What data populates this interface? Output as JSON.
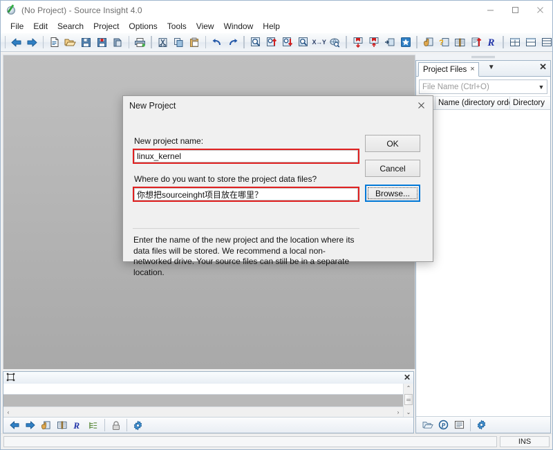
{
  "window": {
    "title": "(No Project) - Source Insight 4.0",
    "app_icon": "source-insight-icon",
    "minimize": "minimize-icon",
    "maximize": "maximize-icon",
    "close": "close-icon"
  },
  "menubar": {
    "items": [
      {
        "label": "File"
      },
      {
        "label": "Edit"
      },
      {
        "label": "Search"
      },
      {
        "label": "Project"
      },
      {
        "label": "Options"
      },
      {
        "label": "Tools"
      },
      {
        "label": "View"
      },
      {
        "label": "Window"
      },
      {
        "label": "Help"
      }
    ]
  },
  "toolbar": {
    "groups": [
      {
        "buttons": [
          {
            "name": "back-arrow-icon",
            "icon": "arrow-left"
          },
          {
            "name": "forward-arrow-icon",
            "icon": "arrow-right"
          }
        ]
      },
      {
        "buttons": [
          {
            "name": "new-file-icon",
            "icon": "new-file"
          },
          {
            "name": "open-file-icon",
            "icon": "open-folder"
          },
          {
            "name": "save-icon",
            "icon": "floppy"
          },
          {
            "name": "save-all-icon",
            "icon": "floppy-red"
          },
          {
            "name": "close-file-icon",
            "icon": "close-doc"
          }
        ]
      },
      {
        "buttons": [
          {
            "name": "print-icon",
            "icon": "printer"
          }
        ]
      },
      {
        "buttons": [
          {
            "name": "cut-icon",
            "icon": "scissors"
          },
          {
            "name": "copy-icon",
            "icon": "copy"
          },
          {
            "name": "paste-icon",
            "icon": "clipboard"
          }
        ]
      },
      {
        "buttons": [
          {
            "name": "undo-icon",
            "icon": "undo"
          },
          {
            "name": "redo-icon",
            "icon": "redo"
          }
        ]
      },
      {
        "buttons": [
          {
            "name": "search-icon",
            "icon": "magnifier"
          },
          {
            "name": "search-backward-icon",
            "icon": "magnifier-up"
          },
          {
            "name": "search-forward-icon",
            "icon": "magnifier-down"
          },
          {
            "name": "search-files-icon",
            "icon": "magnifier-doc"
          },
          {
            "name": "replace-icon",
            "icon": "xy-label",
            "label": "X→Y"
          },
          {
            "name": "search-web-icon",
            "icon": "globe-search"
          }
        ]
      },
      {
        "buttons": [
          {
            "name": "bookmark-prev-icon",
            "icon": "bookmark-left"
          },
          {
            "name": "bookmark-next-icon",
            "icon": "bookmark-right"
          },
          {
            "name": "jump-to-definition-icon",
            "icon": "jump-def"
          },
          {
            "name": "jump-to-caller-icon",
            "icon": "blue-star-box"
          }
        ]
      },
      {
        "buttons": [
          {
            "name": "smart-rename-icon",
            "icon": "hand-doc"
          },
          {
            "name": "context-help-icon",
            "icon": "question-box"
          },
          {
            "name": "browse-project-symbols-icon",
            "icon": "book"
          },
          {
            "name": "symbol-window-icon",
            "icon": "doc-up-arrow"
          },
          {
            "name": "relation-window-icon",
            "icon": "r-script"
          }
        ]
      },
      {
        "buttons": [
          {
            "name": "tile-windows-icon",
            "icon": "grid4"
          },
          {
            "name": "tile-horizontal-icon",
            "icon": "split-h"
          },
          {
            "name": "tile-vertical-icon",
            "icon": "split-v"
          },
          {
            "name": "cascade-windows-icon",
            "icon": "cascade"
          }
        ]
      },
      {
        "buttons": [
          {
            "name": "project-window-icon",
            "icon": "p-circle",
            "active": true
          },
          {
            "name": "context-window-icon",
            "icon": "context-frame",
            "active": true
          },
          {
            "name": "outline-window-icon",
            "icon": "outline"
          }
        ]
      }
    ]
  },
  "right_panel": {
    "tab": {
      "label": "Project Files",
      "close_label": "×"
    },
    "tab_dropdown_icon": "chevron-down-icon",
    "panel_close_label": "✕",
    "search": {
      "placeholder": "File Name (Ctrl+O)",
      "value": "",
      "dropdown_icon": "chevron-down-icon"
    },
    "columns": [
      {
        "label": "✕"
      },
      {
        "label": "Name (directory order"
      },
      {
        "label": "Directory"
      }
    ],
    "rows": [],
    "toolbar_buttons": [
      {
        "name": "open-project-icon",
        "icon": "open-folder-small"
      },
      {
        "name": "project-settings-icon",
        "icon": "p-circle"
      },
      {
        "name": "file-list-icon",
        "icon": "list-doc"
      },
      {
        "name": "panel-options-icon",
        "icon": "gear"
      }
    ]
  },
  "bottom_panel": {
    "header_icon": "context-frame-icon",
    "close_label": "✕",
    "input_value": "",
    "hscroll_left": "‹",
    "hscroll_right": "›",
    "vscroll_up": "⌃",
    "vscroll_down": "⌄",
    "toolbar_buttons": [
      {
        "name": "back-arrow-icon",
        "icon": "arrow-left"
      },
      {
        "name": "forward-arrow-icon",
        "icon": "arrow-right"
      },
      {
        "name": "smart-rename-icon",
        "icon": "hand-doc"
      },
      {
        "name": "browse-symbols-icon",
        "icon": "book"
      },
      {
        "name": "relation-window-icon",
        "icon": "r-script"
      },
      {
        "name": "outline-icon",
        "icon": "outline"
      },
      {
        "name": "lock-icon",
        "icon": "padlock"
      },
      {
        "name": "settings-gear-icon",
        "icon": "gear"
      }
    ]
  },
  "statusbar": {
    "message": "",
    "insert_mode": "INS"
  },
  "dialog": {
    "title": "New Project",
    "close_label": "✕",
    "name_label": "New project name:",
    "name_value": "linux_kernel",
    "location_label": "Where do you want to store the project data files?",
    "location_value": "你想把sourceinght项目放在哪里？",
    "ok_label": "OK",
    "cancel_label": "Cancel",
    "browse_label": "Browse...",
    "help_text": "Enter the name of the new project and the location where its data files will be stored. We recommend a local non-networked drive. Your source files can still be in a separate location.",
    "highlight_color": "#e02020",
    "focus_color": "#0078d7"
  }
}
